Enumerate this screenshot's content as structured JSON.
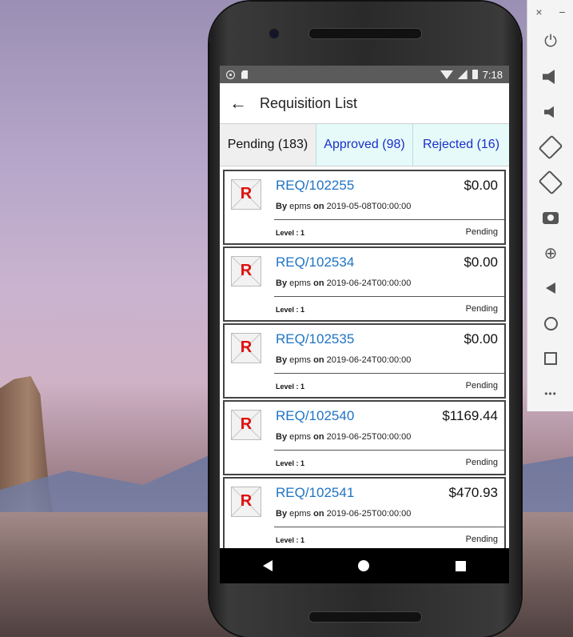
{
  "status_bar": {
    "time": "7:18"
  },
  "app_bar": {
    "back_glyph": "←",
    "title": "Requisition List"
  },
  "tabs": [
    {
      "label": "Pending (183)",
      "active": true
    },
    {
      "label": "Approved (98)",
      "active": false
    },
    {
      "label": "Rejected (16)",
      "active": false
    }
  ],
  "requisitions": [
    {
      "avatar_letter": "R",
      "id": "REQ/102255",
      "amount": "$0.00",
      "by_label": "By",
      "user": "epms",
      "on_label": "on",
      "date": "2019-05-08T00:00:00",
      "level": "Level : 1",
      "status": "Pending"
    },
    {
      "avatar_letter": "R",
      "id": "REQ/102534",
      "amount": "$0.00",
      "by_label": "By",
      "user": "epms",
      "on_label": "on",
      "date": "2019-06-24T00:00:00",
      "level": "Level : 1",
      "status": "Pending"
    },
    {
      "avatar_letter": "R",
      "id": "REQ/102535",
      "amount": "$0.00",
      "by_label": "By",
      "user": "epms",
      "on_label": "on",
      "date": "2019-06-24T00:00:00",
      "level": "Level : 1",
      "status": "Pending"
    },
    {
      "avatar_letter": "R",
      "id": "REQ/102540",
      "amount": "$1169.44",
      "by_label": "By",
      "user": "epms",
      "on_label": "on",
      "date": "2019-06-25T00:00:00",
      "level": "Level : 1",
      "status": "Pending"
    },
    {
      "avatar_letter": "R",
      "id": "REQ/102541",
      "amount": "$470.93",
      "by_label": "By",
      "user": "epms",
      "on_label": "on",
      "date": "2019-06-25T00:00:00",
      "level": "Level : 1",
      "status": "Pending"
    }
  ],
  "emulator_toolbar": {
    "close": "×",
    "minimize": "−",
    "power": "⏻",
    "zoom": "⊕",
    "more": "•••"
  },
  "colors": {
    "link": "#1f73c4",
    "tab_inactive_text": "#1a2fc7",
    "avatar_letter": "#e01010"
  }
}
